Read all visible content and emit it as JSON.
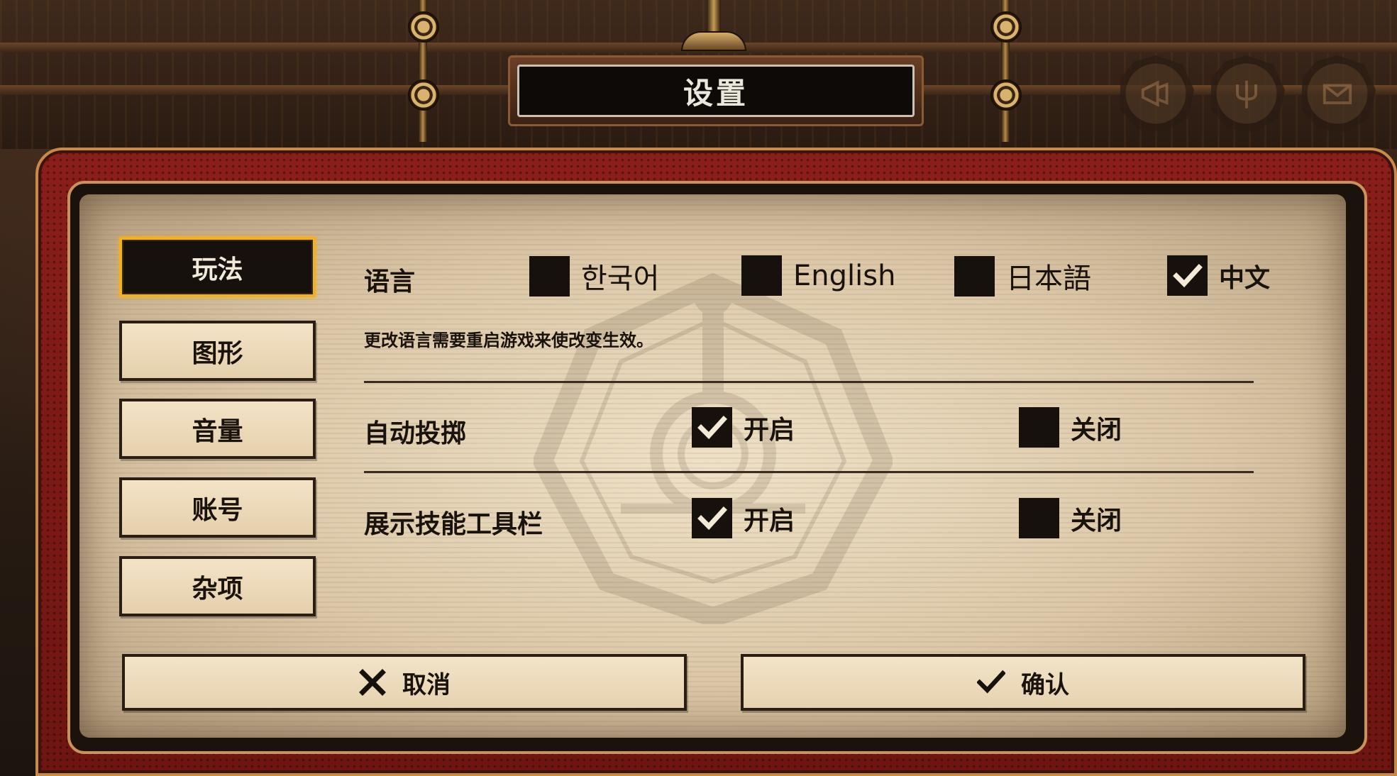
{
  "title": "设置",
  "top_icons": [
    "megaphone-icon",
    "trident-icon",
    "mail-icon"
  ],
  "sidebar": {
    "tabs": [
      {
        "label": "玩法",
        "active": true
      },
      {
        "label": "图形",
        "active": false
      },
      {
        "label": "音量",
        "active": false
      },
      {
        "label": "账号",
        "active": false
      },
      {
        "label": "杂项",
        "active": false
      }
    ]
  },
  "settings": {
    "language": {
      "label": "语言",
      "hint": "更改语言需要重启游戏来使改变生效。",
      "options": [
        {
          "label": "한국어",
          "checked": false
        },
        {
          "label": "English",
          "checked": false
        },
        {
          "label": "日本語",
          "checked": false
        },
        {
          "label": "中文",
          "checked": true
        }
      ]
    },
    "auto_throw": {
      "label": "自动投掷",
      "on_label": "开启",
      "off_label": "关闭",
      "on_checked": true
    },
    "show_skill_toolbar": {
      "label": "展示技能工具栏",
      "on_label": "开启",
      "off_label": "关闭",
      "on_checked": true
    }
  },
  "buttons": {
    "cancel_label": "取消",
    "confirm_label": "确认"
  },
  "colors": {
    "active_tab_border": "#f2b125",
    "panel_red": "#8a1e1a",
    "paper": "#e8d6b8",
    "ink": "#17110d"
  }
}
